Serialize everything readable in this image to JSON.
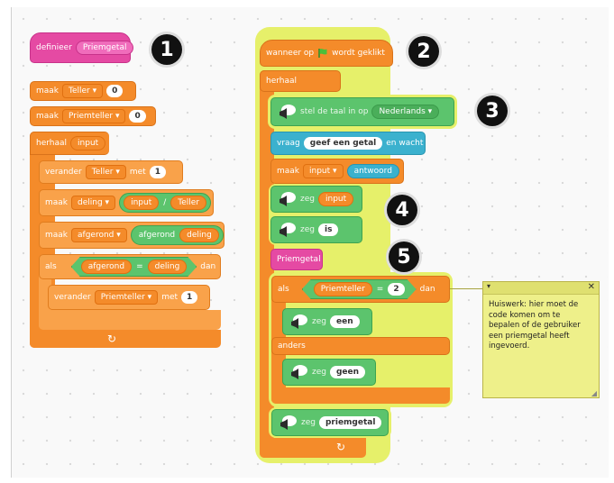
{
  "define": {
    "label": "definieer",
    "name": "Priemgetal"
  },
  "left": {
    "set1": {
      "label": "maak",
      "var": "Teller",
      "value": "0"
    },
    "set2": {
      "label": "maak",
      "var": "Priemteller",
      "value": "0"
    },
    "repeat": {
      "label": "herhaal",
      "arg": "input"
    },
    "change1": {
      "label": "verander",
      "var": "Teller",
      "by": "met",
      "value": "1"
    },
    "set3": {
      "label": "maak",
      "var": "deling",
      "a": "input",
      "op": "/",
      "b": "Teller"
    },
    "set4": {
      "label": "maak",
      "var": "afgerond",
      "fn": "afgerond",
      "arg": "deling"
    },
    "if": {
      "label": "als",
      "a": "afgerond",
      "op": "=",
      "b": "deling",
      "then": "dan"
    },
    "change2": {
      "label": "verander",
      "var": "Priemteller",
      "by": "met",
      "value": "1"
    }
  },
  "right": {
    "hat": {
      "label1": "wanneer op",
      "label2": "wordt geklikt"
    },
    "forever": {
      "label": "herhaal"
    },
    "lang": {
      "label": "stel de taal in op",
      "value": "Nederlands"
    },
    "ask": {
      "label": "vraag",
      "text": "geef een getal",
      "wait": "en wacht"
    },
    "setinput": {
      "label": "maak",
      "var": "input",
      "to": "antwoord"
    },
    "say1": {
      "label": "zeg",
      "arg": "input"
    },
    "say2": {
      "label": "zeg",
      "arg": "is"
    },
    "call": {
      "label": "Priemgetal"
    },
    "if": {
      "label": "als",
      "a": "Priemteller",
      "op": "=",
      "b": "2",
      "then": "dan"
    },
    "say3": {
      "label": "zeg",
      "arg": "een"
    },
    "else": {
      "label": "anders"
    },
    "say4": {
      "label": "zeg",
      "arg": "geen"
    },
    "say5": {
      "label": "zeg",
      "arg": "priemgetal"
    }
  },
  "badges": [
    "1",
    "2",
    "3",
    "4",
    "5"
  ],
  "note": {
    "text": "Huiswerk: hier moet de code komen om te bepalen of de gebruiker een priemgetal heeft ingevoerd."
  },
  "colors": {
    "control": "#f48b2a",
    "pen": "#5cc46d",
    "sensing": "#3bb1ce",
    "custom": "#e54aa3",
    "highlight": "#e6f06a"
  }
}
